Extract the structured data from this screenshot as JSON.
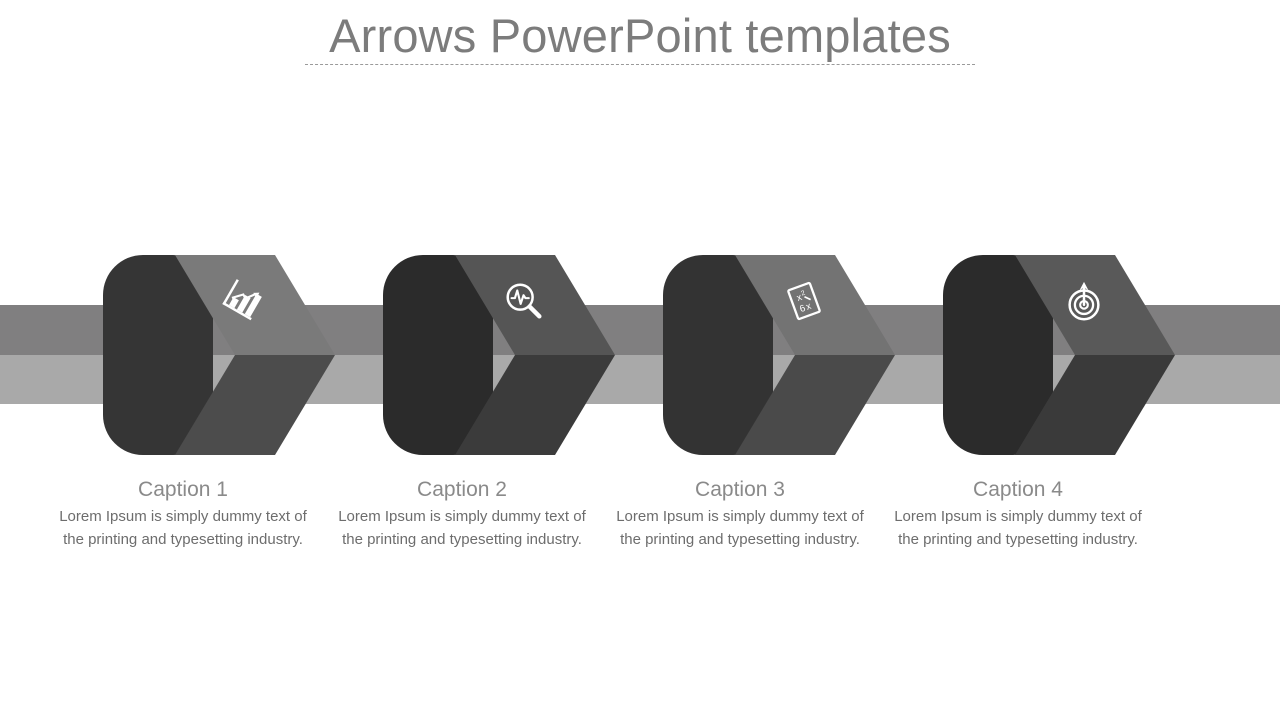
{
  "slide": {
    "title": "Arrows PowerPoint templates",
    "background_color": "#ffffff",
    "title_color": "#7c7c7c",
    "rule_color": "#9a9a9a"
  },
  "ribbon": {
    "top_color": "#807f80",
    "bottom_color": "#a9a9a9"
  },
  "steps": [
    {
      "caption": "Caption 1",
      "body": "Lorem Ipsum is simply dummy text of the printing and typesetting industry.",
      "icon": "bar-chart-growth-icon",
      "base_color": "#353535",
      "face_top_color": "#7a7a7a",
      "face_bottom_color": "#4c4c4c"
    },
    {
      "caption": "Caption 2",
      "body": "Lorem Ipsum is simply dummy text of the printing and typesetting industry.",
      "icon": "magnifier-pulse-icon",
      "base_color": "#2b2b2b",
      "face_top_color": "#555555",
      "face_bottom_color": "#3b3b3b"
    },
    {
      "caption": "Caption 3",
      "body": "Lorem Ipsum is simply dummy text of the printing and typesetting industry.",
      "icon": "formula-document-icon",
      "base_color": "#333333",
      "face_top_color": "#737373",
      "face_bottom_color": "#4a4a4a"
    },
    {
      "caption": "Caption 4",
      "body": "Lorem Ipsum is simply dummy text of the printing and typesetting industry.",
      "icon": "target-dart-icon",
      "base_color": "#2b2b2b",
      "face_top_color": "#595959",
      "face_bottom_color": "#3a3a3a"
    }
  ]
}
